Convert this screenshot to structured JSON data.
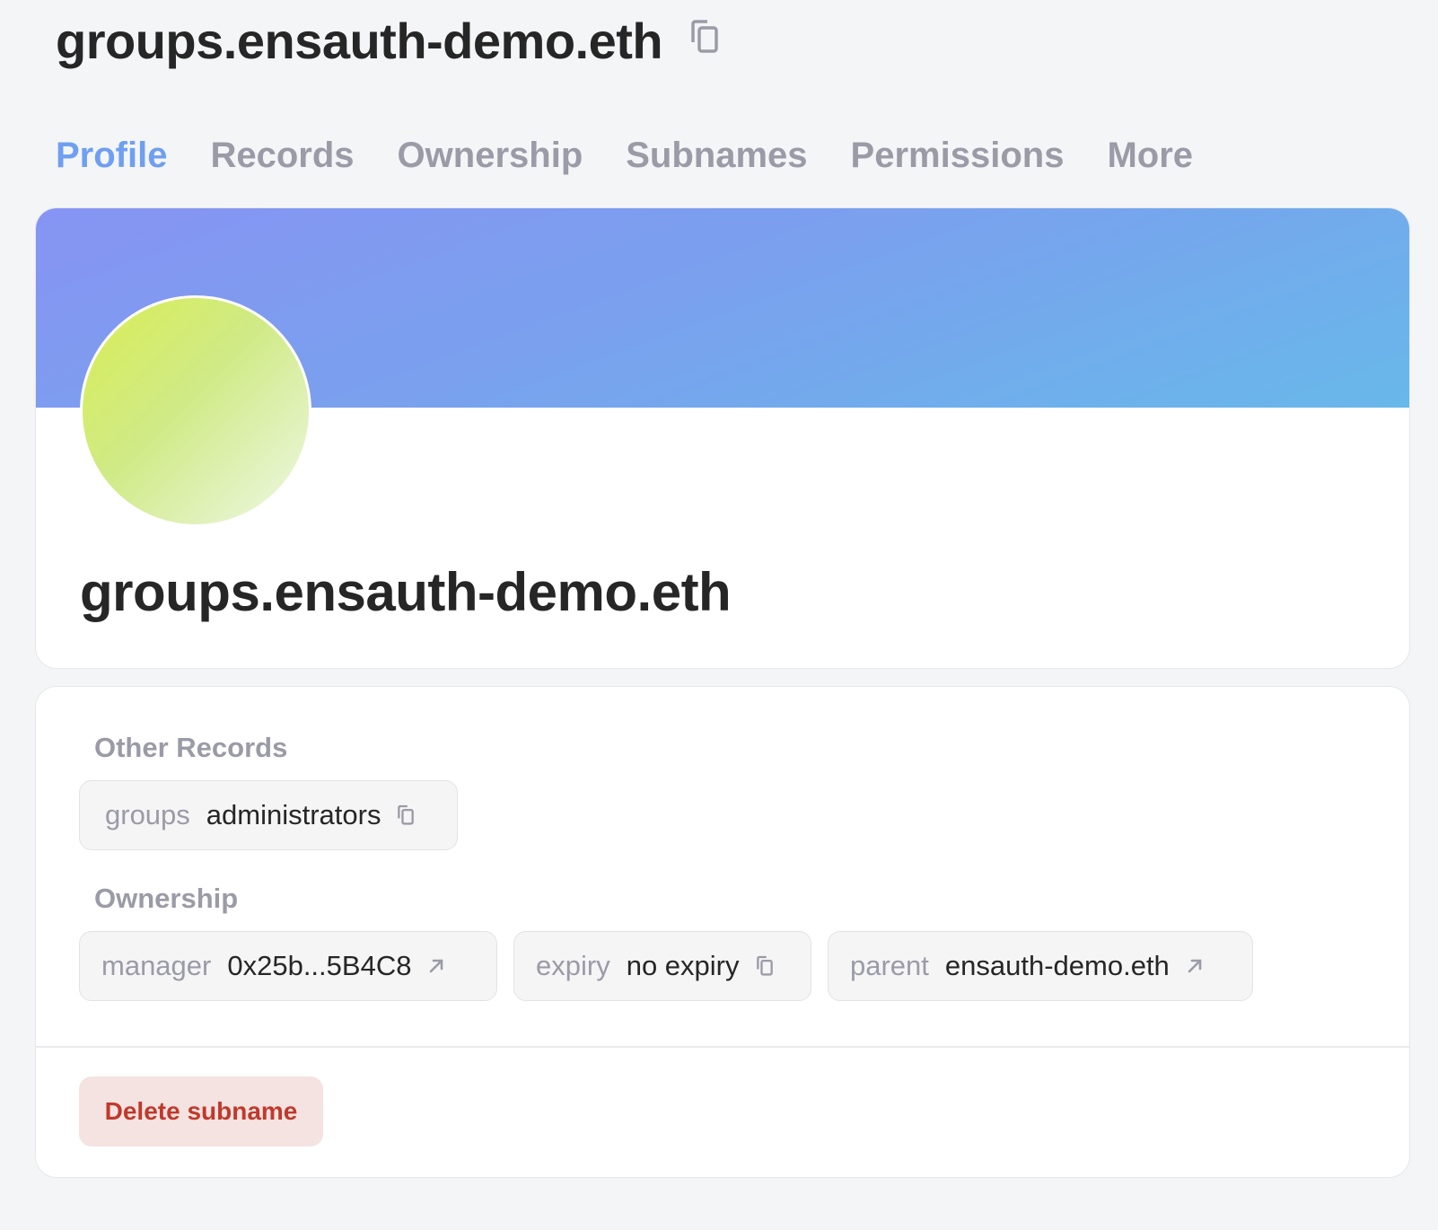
{
  "header": {
    "title": "groups.ensauth-demo.eth"
  },
  "tabs": [
    {
      "label": "Profile",
      "active": true
    },
    {
      "label": "Records",
      "active": false
    },
    {
      "label": "Ownership",
      "active": false
    },
    {
      "label": "Subnames",
      "active": false
    },
    {
      "label": "Permissions",
      "active": false
    },
    {
      "label": "More",
      "active": false
    }
  ],
  "profile": {
    "name": "groups.ensauth-demo.eth",
    "banner_colors": [
      "#8694f3",
      "#68b8ea"
    ],
    "avatar_colors": [
      "#d9ee55",
      "#eef8e6"
    ]
  },
  "other_records": {
    "label": "Other Records",
    "items": [
      {
        "key": "groups",
        "value": "administrators",
        "icon": "copy-icon"
      }
    ]
  },
  "ownership": {
    "label": "Ownership",
    "items": [
      {
        "key": "manager",
        "value": "0x25b...5B4C8",
        "icon": "external-link-icon"
      },
      {
        "key": "expiry",
        "value": "no expiry",
        "icon": "copy-icon"
      },
      {
        "key": "parent",
        "value": "ensauth-demo.eth",
        "icon": "external-link-icon"
      }
    ]
  },
  "actions": {
    "delete_label": "Delete subname"
  },
  "colors": {
    "accent": "#6f9ff0",
    "muted": "#9b9ba7",
    "danger": "#c0392b",
    "danger_bg": "#f5e3e1"
  }
}
